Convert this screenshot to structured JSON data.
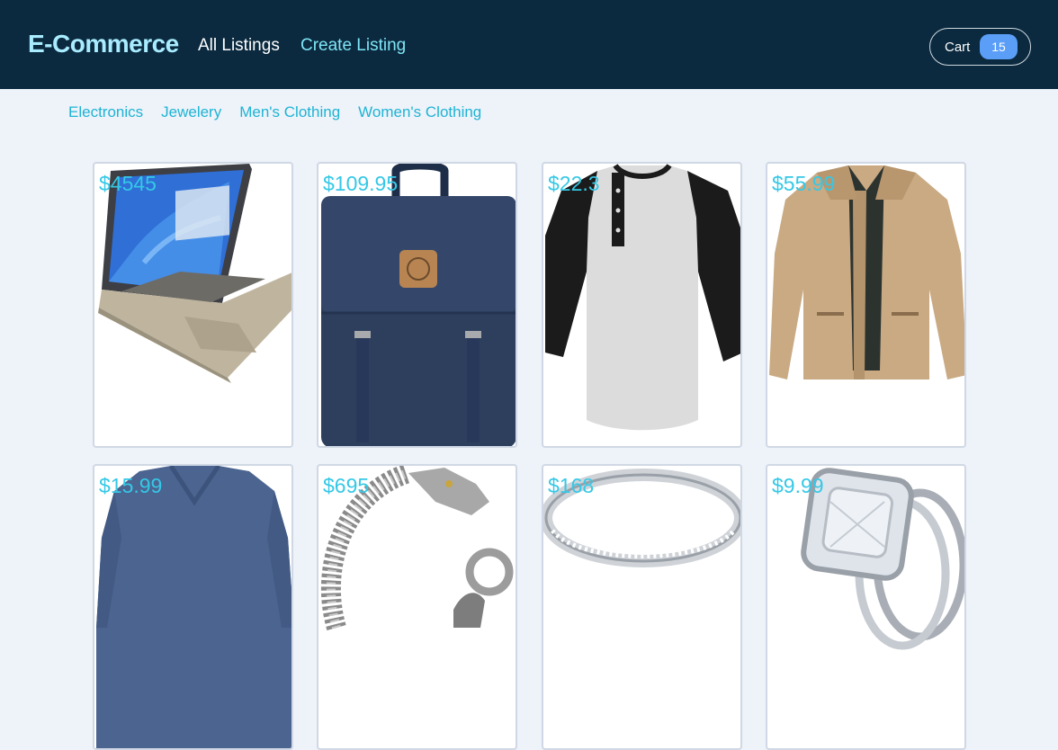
{
  "navbar": {
    "brand": "E-Commerce",
    "links": [
      "All Listings",
      "Create Listing"
    ],
    "cart": {
      "label": "Cart",
      "count": "15"
    }
  },
  "categories": [
    "Electronics",
    "Jewelery",
    "Men's Clothing",
    "Women's Clothing"
  ],
  "products": [
    {
      "price": "$4545",
      "image": "laptop"
    },
    {
      "price": "$109.95",
      "image": "backpack"
    },
    {
      "price": "$22.3",
      "image": "raglan-henley-shirt"
    },
    {
      "price": "$55.99",
      "image": "khaki-jacket"
    },
    {
      "price": "$15.99",
      "image": "blue-v-neck-shirt"
    },
    {
      "price": "$695",
      "image": "dragon-bracelet"
    },
    {
      "price": "$168",
      "image": "silver-ring"
    },
    {
      "price": "$9.99",
      "image": "diamond-ring"
    }
  ],
  "colors": {
    "navbar_bg": "#0b2a3f",
    "brand": "#a9ecff",
    "accent": "#1eb4d4",
    "price": "#35c8e6",
    "badge": "#5b9ef8",
    "page_bg": "#eef2f9"
  }
}
